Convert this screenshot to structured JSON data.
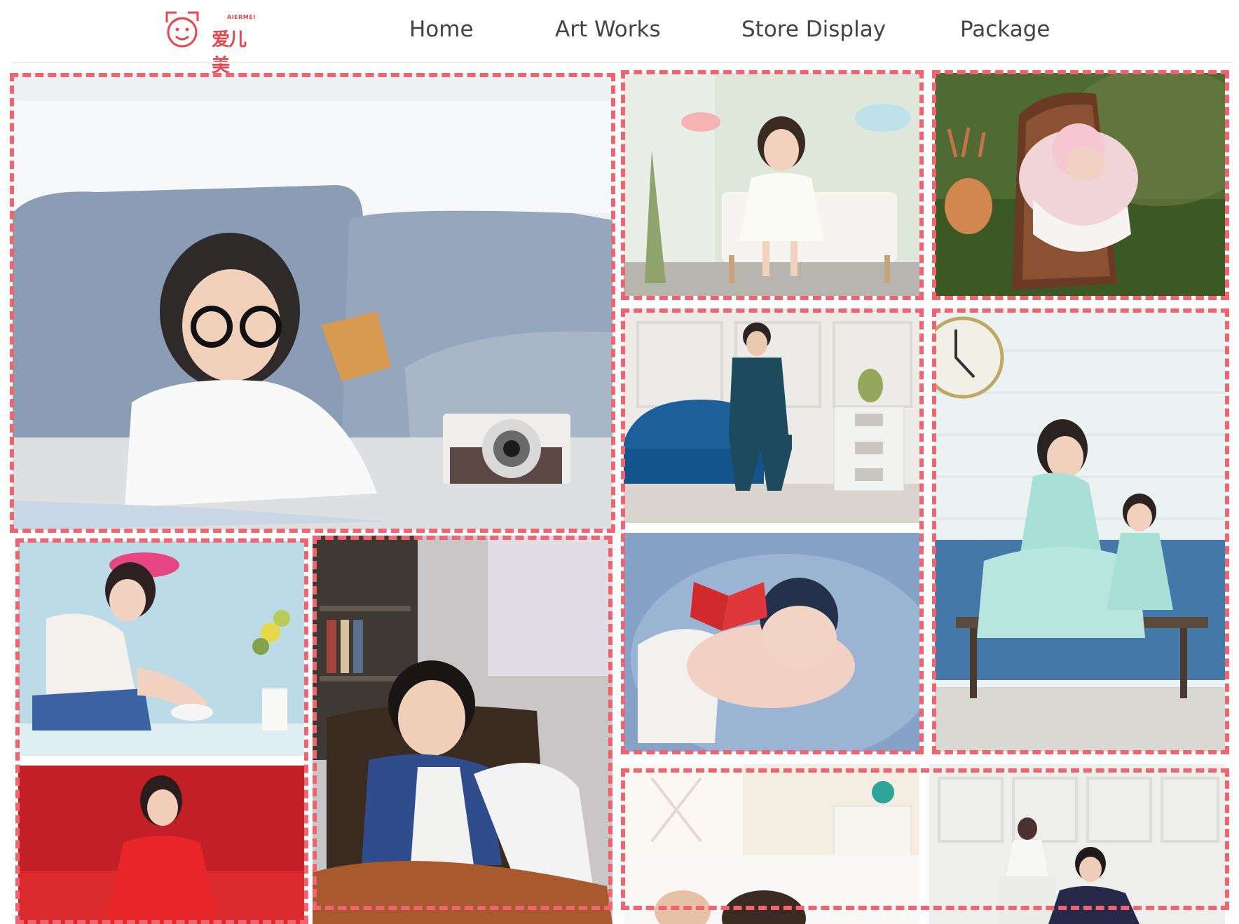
{
  "header": {
    "logo": {
      "name": "logo",
      "latin_text": "AIERMEI",
      "cn_text": "爱儿美",
      "color": "#e8454f"
    },
    "nav": [
      {
        "label": "Home"
      },
      {
        "label": "Art Works"
      },
      {
        "label": "Store Display"
      },
      {
        "label": "Package"
      }
    ]
  },
  "gallery": {
    "highlight_color": "#f06470",
    "items": [
      {
        "subject": "girl-with-glasses-and-camera"
      },
      {
        "subject": "girl-on-white-bench"
      },
      {
        "subject": "newborn-in-wooden-bucket"
      },
      {
        "subject": "boy-in-suit-on-blue-sofa"
      },
      {
        "subject": "mother-and-daughter-by-clock-wall"
      },
      {
        "subject": "sleeping-baby-with-red-bow"
      },
      {
        "subject": "girl-with-flowers"
      },
      {
        "subject": "boy-in-leather-chair"
      },
      {
        "subject": "woman-in-red-dress"
      },
      {
        "subject": "mother-and-child-in-bedroom"
      },
      {
        "subject": "father-and-daughter-by-white-wall"
      }
    ]
  }
}
